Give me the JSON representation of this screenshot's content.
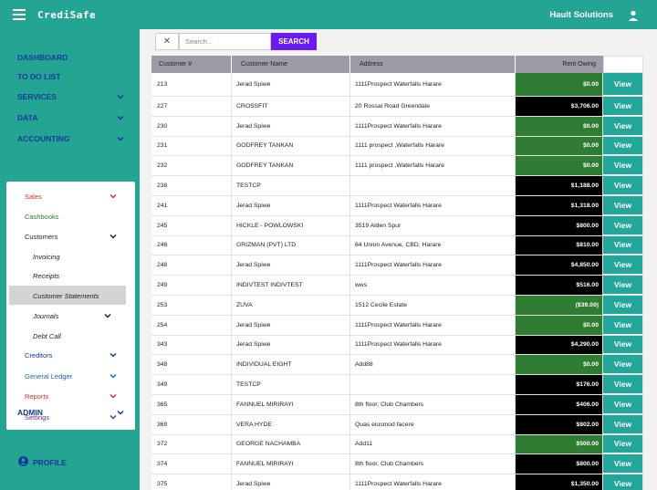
{
  "app": {
    "brand": "CrediSafe",
    "company": "Hault Solutions"
  },
  "sidebar": {
    "main_items": [
      {
        "label": "DASHBOARD"
      },
      {
        "label": "TO DO LIST"
      },
      {
        "label": "SERVICES"
      },
      {
        "label": "DATA"
      },
      {
        "label": "ACCOUNTING"
      }
    ],
    "sub_items": [
      {
        "label": "Sales"
      },
      {
        "label": "Cashbooks"
      },
      {
        "label": "Customers"
      },
      {
        "label": "Invoicing"
      },
      {
        "label": "Receipts"
      },
      {
        "label": "Customer Statements"
      },
      {
        "label": "Journals"
      },
      {
        "label": "Debt Call"
      },
      {
        "label": "Creditors"
      },
      {
        "label": "General Ledger"
      },
      {
        "label": "Reports"
      },
      {
        "label": "Settings"
      }
    ],
    "admin": "ADMIN",
    "profile": "PROFILE"
  },
  "toolbar": {
    "clear_label": "✕",
    "search_placeholder": "Search...",
    "search_label": "SEARCH"
  },
  "table": {
    "headers": [
      "Customer #",
      "Customer Name",
      "Address",
      "Rent Owing"
    ],
    "view_label": "View",
    "rows": [
      {
        "id": "213",
        "name": "Jerad Spiwe",
        "address": "1111Prospect Waterfalls Harare",
        "owing": "$0.00",
        "status": "green"
      },
      {
        "id": "227",
        "name": "CROSSFIT",
        "address": "20 Rossal Road Greendale",
        "owing": "$3,706.00",
        "status": "black"
      },
      {
        "id": "230",
        "name": "Jerad Spiwe",
        "address": "1111Prospect Waterfalls Harare",
        "owing": "$0.00",
        "status": "green"
      },
      {
        "id": "231",
        "name": "GODFREY TANKAN",
        "address": "1111 prospect ,Waterfalls Harare",
        "owing": "$0.00",
        "status": "green"
      },
      {
        "id": "232",
        "name": "GODFREY TANKAN",
        "address": "1111 prospect ,Waterfalls Harare",
        "owing": "$0.00",
        "status": "green"
      },
      {
        "id": "238",
        "name": "TESTCP",
        "address": "",
        "owing": "$1,188.00",
        "status": "black"
      },
      {
        "id": "241",
        "name": "Jerad Spiwe",
        "address": "1111Prospect Waterfalls Harare",
        "owing": "$1,318.00",
        "status": "black"
      },
      {
        "id": "245",
        "name": "HICKLE - POWLOWSKI",
        "address": "3519 Alden Spur",
        "owing": "$800.00",
        "status": "black"
      },
      {
        "id": "246",
        "name": "GRIZMAN (PVT) LTD",
        "address": "64 Union Avenue, CBD, Harare",
        "owing": "$810.00",
        "status": "black"
      },
      {
        "id": "248",
        "name": "Jerad Spiwe",
        "address": "1111Prospect Waterfalls Harare",
        "owing": "$4,850.00",
        "status": "black"
      },
      {
        "id": "249",
        "name": "INDIVTEST INDIVTEST",
        "address": "wws",
        "owing": "$516.00",
        "status": "black"
      },
      {
        "id": "253",
        "name": "ZUVA",
        "address": "1512 Cecile Estate",
        "owing": "($39.00)",
        "status": "green"
      },
      {
        "id": "254",
        "name": "Jerad Spiwe",
        "address": "1111Prospect Waterfalls Harare",
        "owing": "$0.00",
        "status": "green"
      },
      {
        "id": "343",
        "name": "Jerad Spiwe",
        "address": "1111Prospect Waterfalls Harare",
        "owing": "$4,290.00",
        "status": "black"
      },
      {
        "id": "348",
        "name": "INDIVIDUAL EIGHT",
        "address": "Add88",
        "owing": "$0.00",
        "status": "green"
      },
      {
        "id": "349",
        "name": "TESTCP",
        "address": "",
        "owing": "$176.00",
        "status": "black"
      },
      {
        "id": "365",
        "name": "FANNUEL MIRIRAYI",
        "address": "8th floor, Club Chambers",
        "owing": "$406.00",
        "status": "black"
      },
      {
        "id": "369",
        "name": "VERA HYDE",
        "address": "Quas eiusmod facere",
        "owing": "$802.00",
        "status": "black"
      },
      {
        "id": "372",
        "name": "GEORGE NACHAMBA",
        "address": "Add11",
        "owing": "$500.00",
        "status": "green"
      },
      {
        "id": "374",
        "name": "FANNUEL MIRIRAYI",
        "address": "8th floor, Club Chambers",
        "owing": "$800.00",
        "status": "black"
      },
      {
        "id": "375",
        "name": "Jerad Spiwe",
        "address": "1111Prospect Waterfalls Harare",
        "owing": "$1,350.00",
        "status": "black"
      }
    ]
  },
  "colors": {
    "teal": "#24a594",
    "green": "#2e7d32",
    "black": "#000000",
    "purple": "#6a1bf0",
    "nav_blue": "#0d3b9a"
  }
}
